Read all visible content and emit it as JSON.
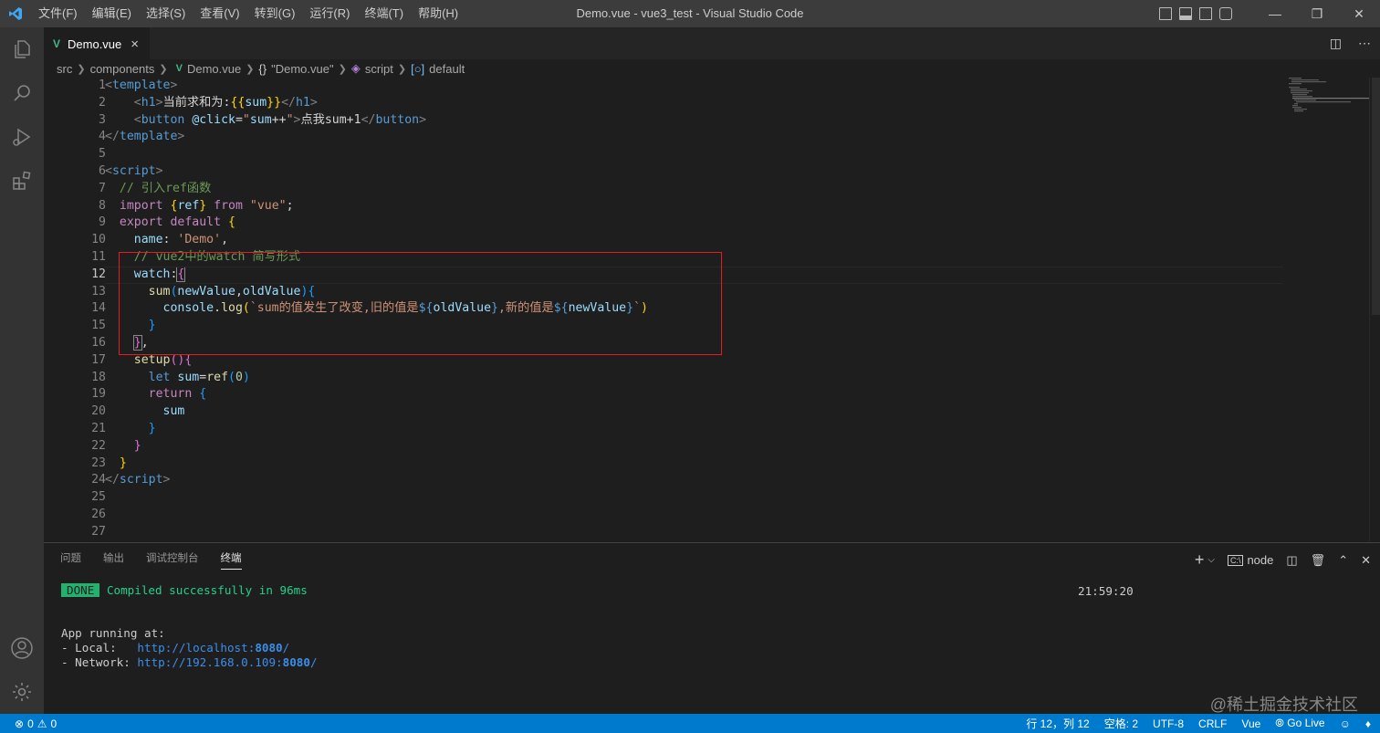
{
  "app": {
    "menu": [
      "文件(F)",
      "编辑(E)",
      "选择(S)",
      "查看(V)",
      "转到(G)",
      "运行(R)",
      "终端(T)",
      "帮助(H)"
    ],
    "window_title": "Demo.vue - vue3_test - Visual Studio Code"
  },
  "tab": {
    "label": "Demo.vue",
    "close": "×"
  },
  "breadcrumb": {
    "src": "src",
    "components": "components",
    "file": "Demo.vue",
    "obj": "\"Demo.vue\"",
    "script": "script",
    "default": "default"
  },
  "editor": {
    "line_numbers": [
      "1",
      "2",
      "3",
      "4",
      "5",
      "6",
      "7",
      "8",
      "9",
      "10",
      "11",
      "12",
      "13",
      "14",
      "15",
      "16",
      "17",
      "18",
      "19",
      "20",
      "21",
      "22",
      "23",
      "24",
      "25",
      "26",
      "27"
    ],
    "current_line": 12
  },
  "panel": {
    "tabs": [
      "问题",
      "输出",
      "调试控制台",
      "终端"
    ],
    "active_tab": "终端",
    "shell": "node",
    "terminal": {
      "done": "DONE",
      "compiled": "Compiled successfully in 96ms",
      "time": "21:59:20",
      "app_running": "App running at:",
      "local_label": "- Local:   ",
      "local_url_a": "http://localhost:",
      "local_port": "8080",
      "local_url_b": "/",
      "network_label": "- Network: ",
      "network_url_a": "http://192.168.0.109:",
      "network_port": "8080",
      "network_url_b": "/"
    }
  },
  "status": {
    "errors": "0",
    "warnings": "0",
    "position": "行 12，列 12",
    "spaces": "空格: 2",
    "encoding": "UTF-8",
    "eol": "CRLF",
    "language": "Vue",
    "golive": "Go Live"
  },
  "watermark": "@稀土掘金技术社区",
  "colors": {
    "accent": "#007acc",
    "highlight_box": "#e51c23",
    "done_bg": "#23b16e"
  }
}
